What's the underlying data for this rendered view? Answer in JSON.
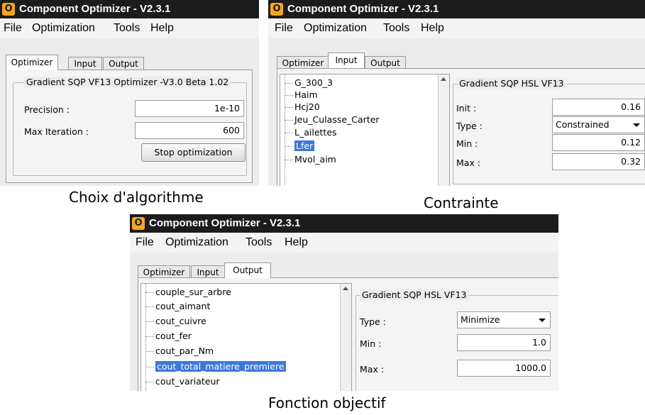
{
  "window_title": "Component Optimizer - V2.3.1",
  "app_icon_glyph": "O",
  "menu": [
    "File",
    "Optimization",
    "Tools",
    "Help"
  ],
  "tabs": [
    "Optimizer",
    "Input",
    "Output"
  ],
  "optimizer": {
    "group_title": "Gradient SQP VF13 Optimizer -V3.0 Beta 1.02",
    "precision_label": "Precision :",
    "precision_value": "1e-10",
    "max_iter_label": "Max Iteration :",
    "max_iter_value": "600",
    "stop_button": "Stop optimization",
    "caption": "Choix d'algorithme"
  },
  "input": {
    "tree_items": [
      "G_300_3",
      "Haim",
      "Hcj20",
      "Jeu_Culasse_Carter",
      "L_ailettes",
      "Lfer",
      "Mvol_aim"
    ],
    "selected_item": "Lfer",
    "group_title": "Gradient SQP HSL VF13",
    "init_label": "Init :",
    "init_value": "0.16",
    "type_label": "Type :",
    "type_value": "Constrained",
    "min_label": "Min :",
    "min_value": "0.12",
    "max_label": "Max :",
    "max_value": "0.32",
    "caption": "Contrainte"
  },
  "output": {
    "tree_items": [
      "couple_sur_arbre",
      "cout_aimant",
      "cout_cuivre",
      "cout_fer",
      "cout_par_Nm",
      "cout_total_matiere_premiere",
      "cout_variateur"
    ],
    "selected_item": "cout_total_matiere_premiere",
    "group_title": "Gradient SQP HSL VF13",
    "type_label": "Type :",
    "type_value": "Minimize",
    "min_label": "Min :",
    "min_value": "1.0",
    "max_label": "Max :",
    "max_value": "1000.0",
    "caption": "Fonction objectif"
  },
  "colors": {
    "titlebar": "#1c1c1c",
    "selection": "#3b78d8",
    "icon": "#f5a623"
  }
}
